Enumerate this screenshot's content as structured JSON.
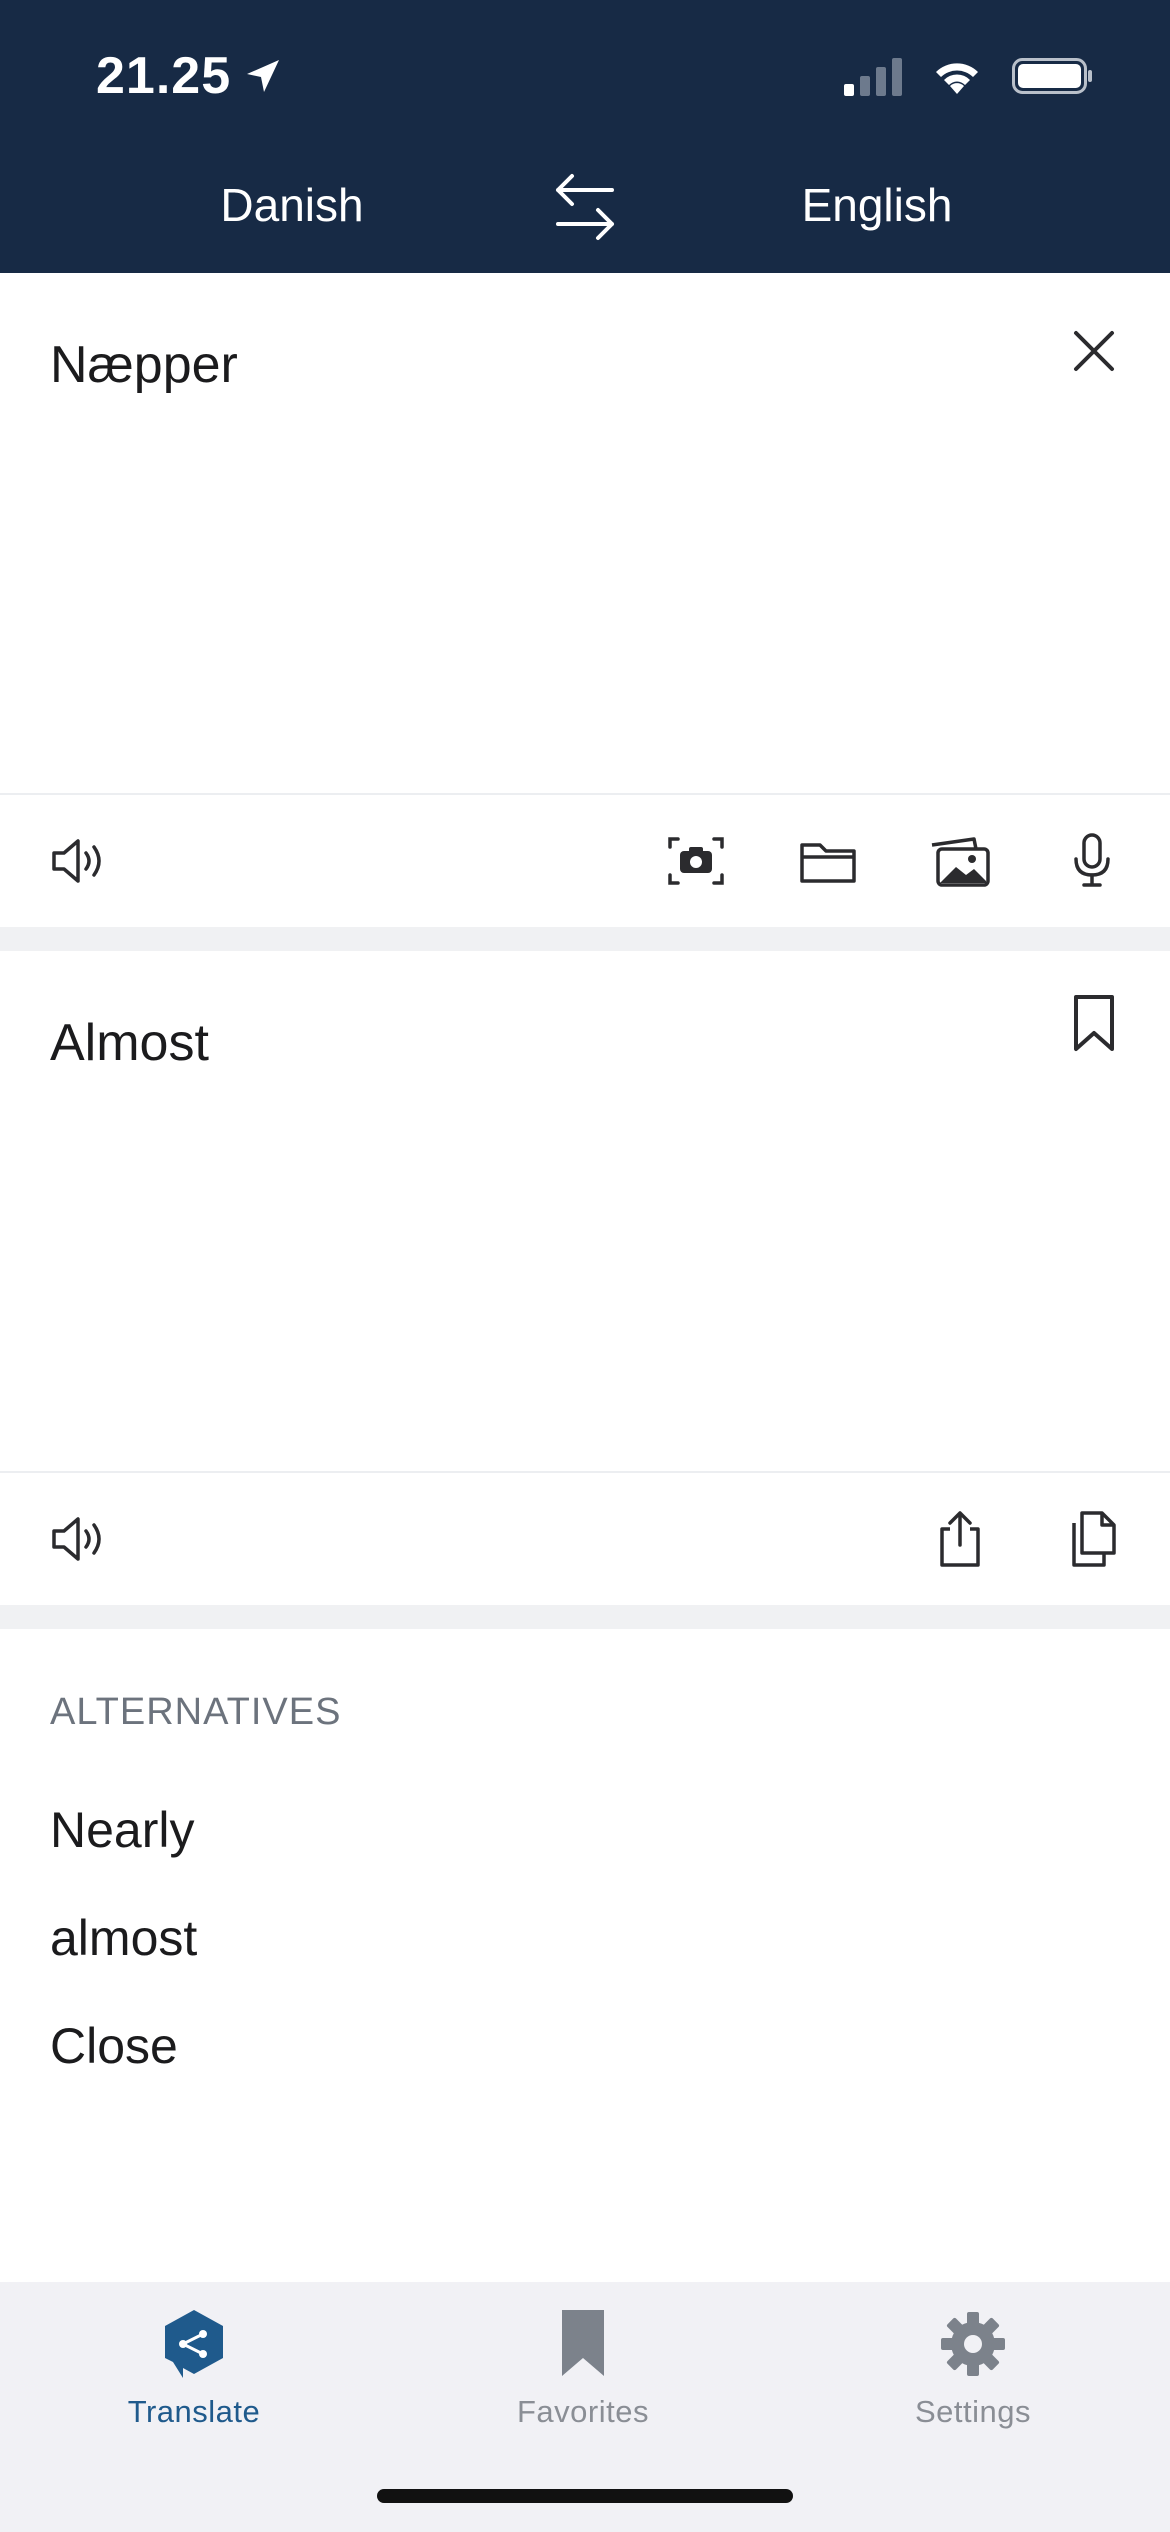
{
  "status_bar": {
    "time": "21.25"
  },
  "languages": {
    "source": "Danish",
    "target": "English"
  },
  "source_panel": {
    "text": "Næpper"
  },
  "target_panel": {
    "text": "Almost"
  },
  "alternatives": {
    "heading": "ALTERNATIVES",
    "items": [
      "Nearly",
      "almost",
      "Close"
    ]
  },
  "tabbar": {
    "tabs": [
      {
        "label": "Translate",
        "icon": "translate-icon",
        "active": true
      },
      {
        "label": "Favorites",
        "icon": "bookmark-icon",
        "active": false
      },
      {
        "label": "Settings",
        "icon": "gear-icon",
        "active": false
      }
    ]
  },
  "colors": {
    "header_bg": "#172a45",
    "accent": "#1f5a8c",
    "inactive": "#8a8e95"
  }
}
